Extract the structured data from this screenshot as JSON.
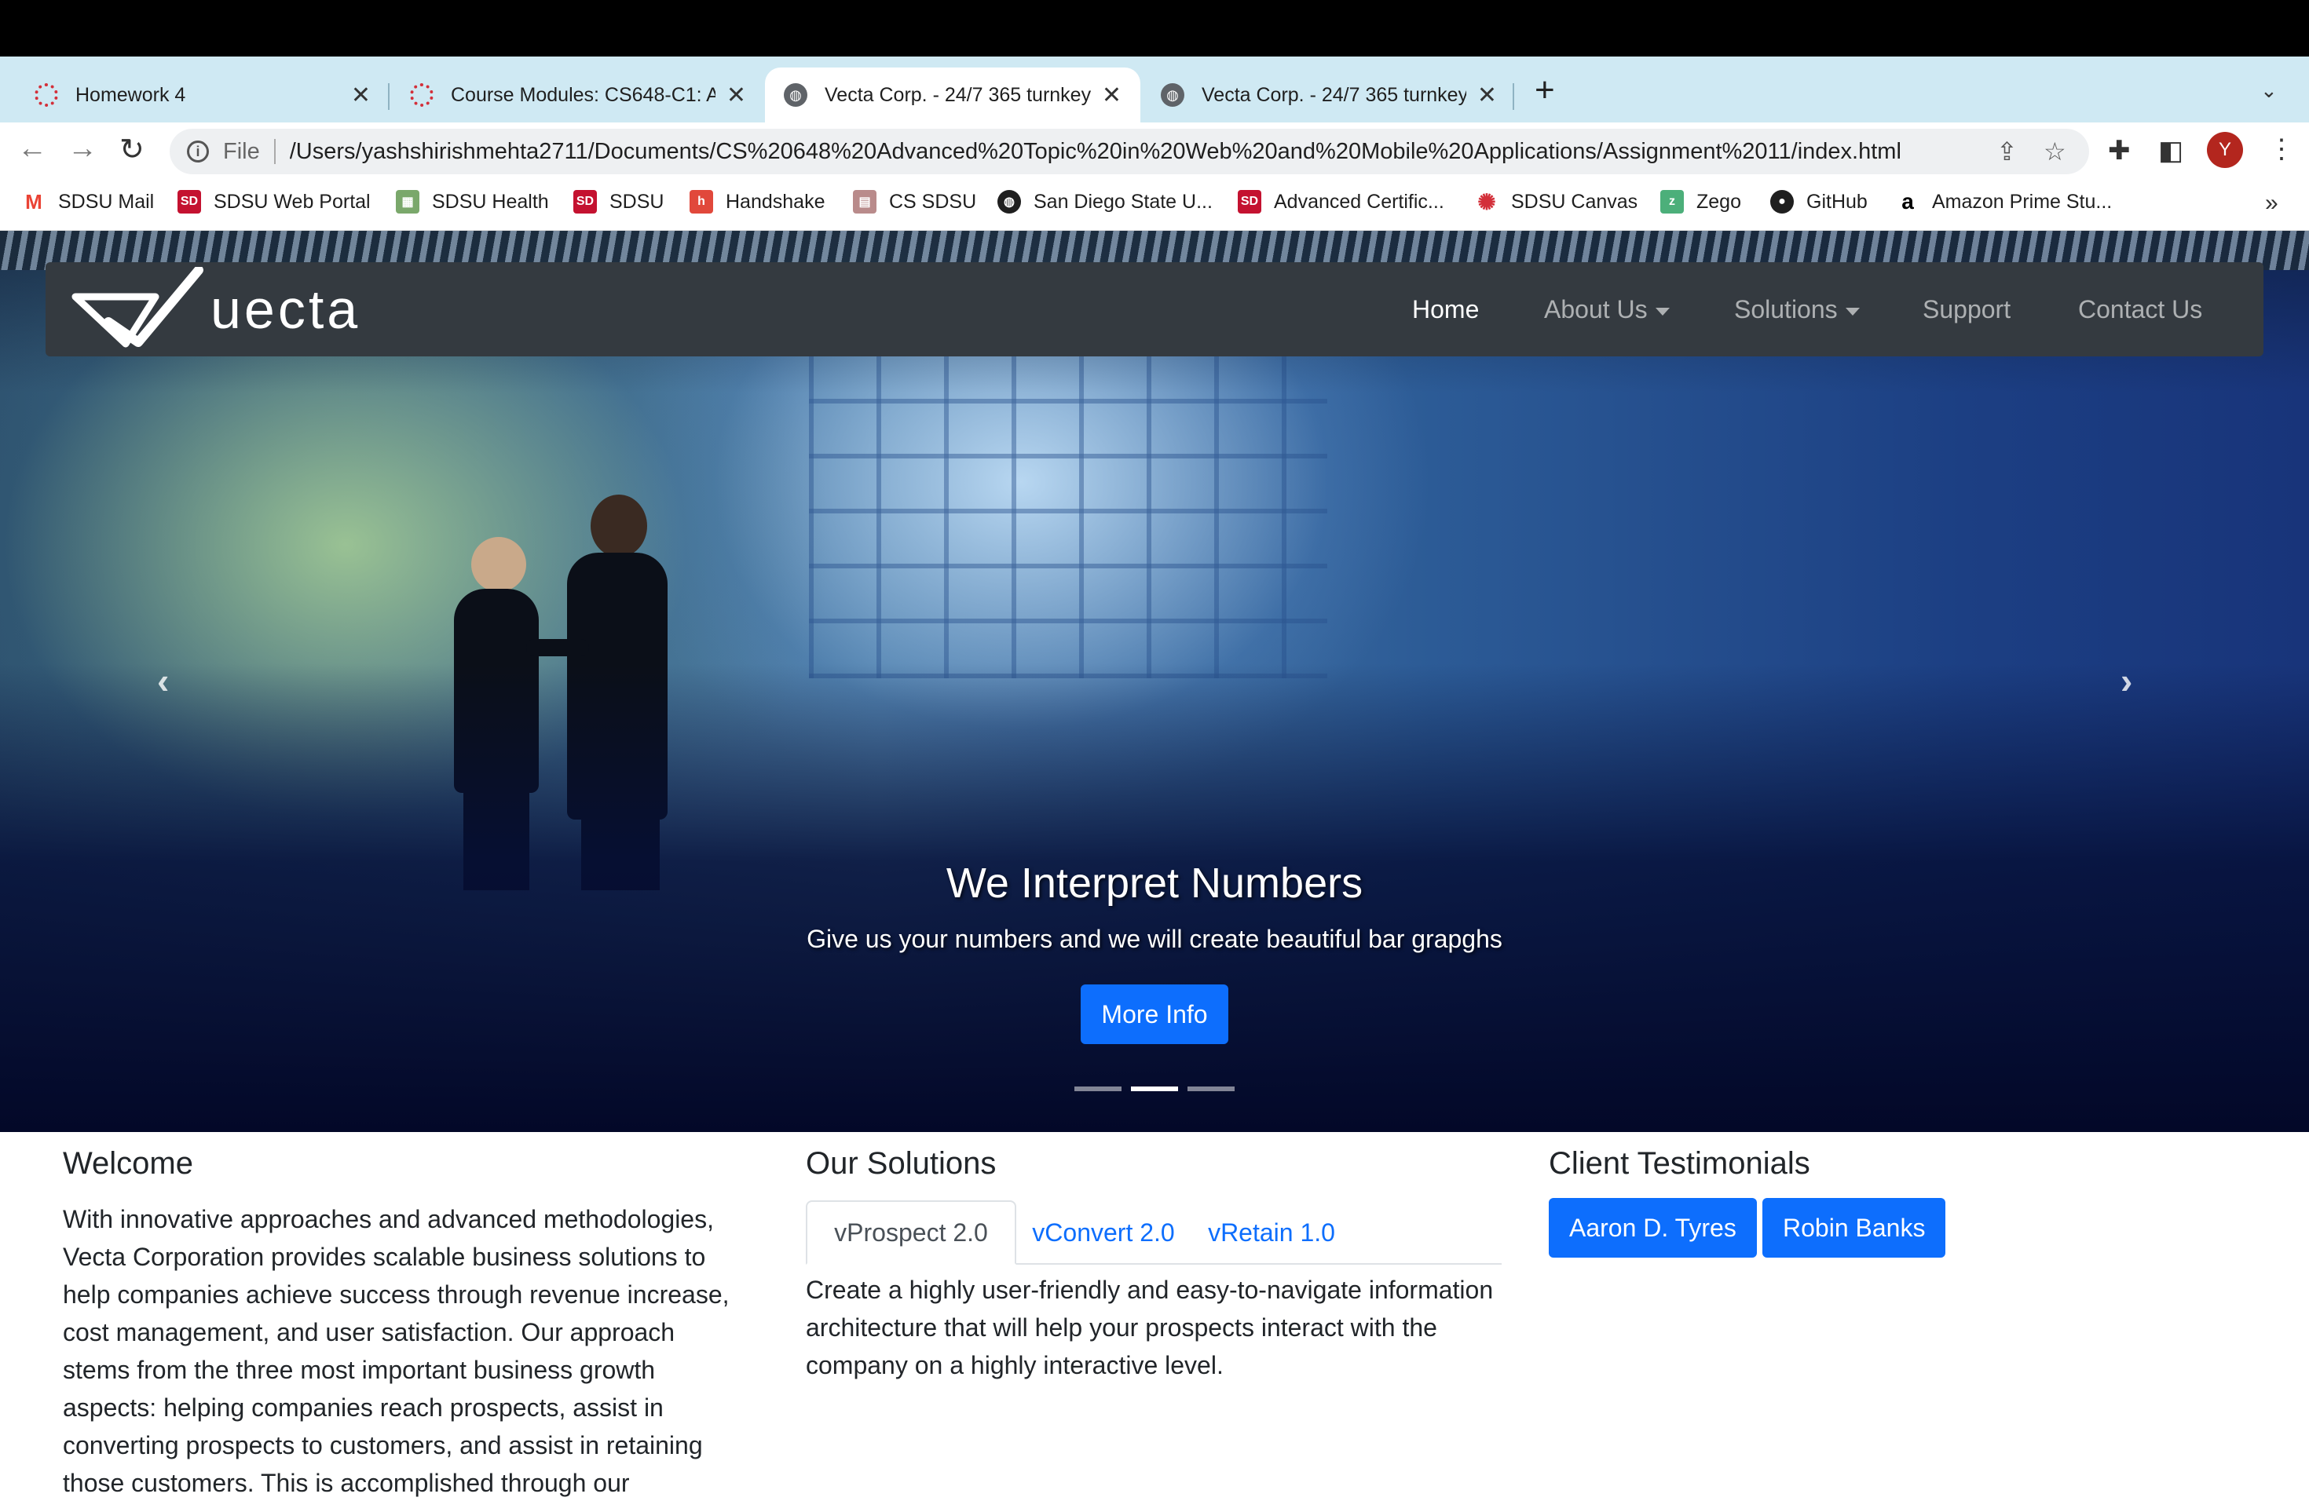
{
  "browser": {
    "tabs": [
      {
        "title": "Homework 4",
        "icon": "canvas-icon"
      },
      {
        "title": "Course Modules: CS648-C1: A",
        "icon": "canvas-icon"
      },
      {
        "title": "Vecta Corp. - 24/7 365 turnkey",
        "icon": "globe-icon"
      },
      {
        "title": "Vecta Corp. - 24/7 365 turnkey",
        "icon": "globe-icon"
      }
    ],
    "scheme": "File",
    "url": "/Users/yashshirishmehta2711/Documents/CS%20648%20Advanced%20Topic%20in%20Web%20and%20Mobile%20Applications/Assignment%2011/index.html",
    "profile_initial": "Y",
    "bookmarks": [
      {
        "label": "SDSU Mail",
        "icon": "gmail-icon",
        "color": "#ea4335",
        "glyph": "M"
      },
      {
        "label": "SDSU Web Portal",
        "icon": "sdsu-icon",
        "color": "#c41230",
        "glyph": "SD"
      },
      {
        "label": "SDSU Health",
        "icon": "health-icon",
        "color": "#7aa86b",
        "glyph": "▦"
      },
      {
        "label": "SDSU",
        "icon": "sdsu-icon",
        "color": "#c41230",
        "glyph": "SD"
      },
      {
        "label": "Handshake",
        "icon": "handshake-icon",
        "color": "#e1483b",
        "glyph": "h"
      },
      {
        "label": "CS SDSU",
        "icon": "cs-sdsu-icon",
        "color": "#b98b8b",
        "glyph": "▤"
      },
      {
        "label": "San Diego State U...",
        "icon": "globe-icon",
        "color": "#1f1f1f",
        "glyph": "◉"
      },
      {
        "label": "Advanced Certific...",
        "icon": "sdsu-icon",
        "color": "#c41230",
        "glyph": "SD"
      },
      {
        "label": "SDSU Canvas",
        "icon": "canvas-icon",
        "color": "#d3303a",
        "glyph": "✺"
      },
      {
        "label": "Zego",
        "icon": "zego-icon",
        "color": "#4caf7a",
        "glyph": "z"
      },
      {
        "label": "GitHub",
        "icon": "github-icon",
        "color": "#1f1f1f",
        "glyph": "●"
      },
      {
        "label": "Amazon Prime Stu...",
        "icon": "amazon-icon",
        "color": "#000000",
        "glyph": "a"
      }
    ]
  },
  "site": {
    "brand": "uecta",
    "nav": [
      {
        "label": "Home",
        "active": true
      },
      {
        "label": "About Us",
        "dropdown": true
      },
      {
        "label": "Solutions",
        "dropdown": true
      },
      {
        "label": "Support"
      },
      {
        "label": "Contact Us"
      }
    ],
    "carousel": {
      "title": "We Interpret Numbers",
      "subtitle": "Give us your numbers and we will create beautiful bar grapghs",
      "button": "More Info",
      "active_slide": 2,
      "slide_count": 3
    },
    "welcome": {
      "heading": "Welcome",
      "text": "With innovative approaches and advanced methodologies, Vecta Corporation provides scalable business solutions to help companies achieve success through revenue increase, cost management, and user satisfaction. Our approach stems from the three most important business growth aspects: helping companies reach prospects, assist in converting prospects to customers, and assist in retaining those customers. This is accomplished through our"
    },
    "solutions": {
      "heading": "Our Solutions",
      "tabs": [
        "vProspect 2.0",
        "vConvert 2.0",
        "vRetain 1.0"
      ],
      "active_tab": 0,
      "text": "Create a highly user-friendly and easy-to-navigate information architecture that will help your prospects interact with the company on a highly interactive level."
    },
    "testimonials": {
      "heading": "Client Testimonials",
      "buttons": [
        "Aaron D. Tyres",
        "Robin Banks"
      ]
    }
  },
  "colors": {
    "primary": "#0d6efd",
    "navbar": "#343a40",
    "tabstrip": "#cfe9f3"
  }
}
